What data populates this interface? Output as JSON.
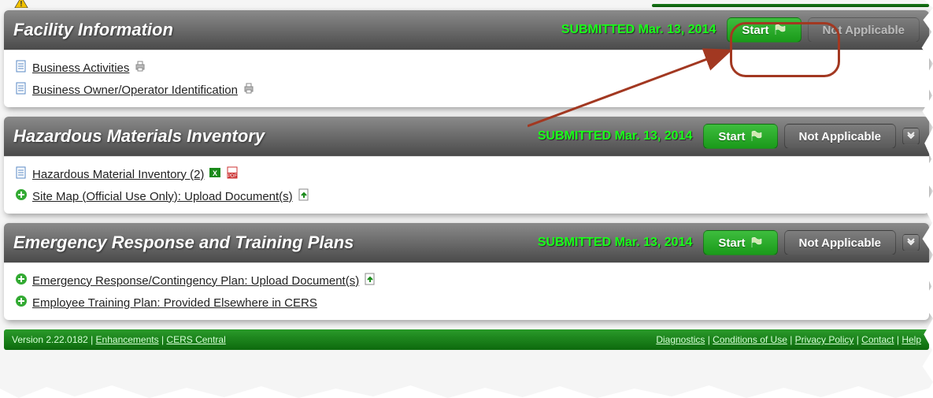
{
  "sections": [
    {
      "title": "Facility Information",
      "status": "SUBMITTED Mar. 13, 2014",
      "start": "Start",
      "na": "Not Applicable",
      "rows": [
        {
          "icon": "doc",
          "text": "Business Activities",
          "trail": "print"
        },
        {
          "icon": "doc",
          "text": "Business Owner/Operator Identification",
          "trail": "print"
        }
      ],
      "highlighted": true,
      "show_na_faded": true
    },
    {
      "title": "Hazardous Materials Inventory",
      "status": "SUBMITTED Mar. 13, 2014",
      "start": "Start",
      "na": "Not Applicable",
      "rows": [
        {
          "icon": "doc",
          "text": "Hazardous Material Inventory (2)",
          "trail": "xlspdf"
        },
        {
          "icon": "plus",
          "text": "Site Map (Official Use Only): Upload Document(s)",
          "trail": "upload"
        }
      ]
    },
    {
      "title": "Emergency Response and Training Plans",
      "status": "SUBMITTED Mar. 13, 2014",
      "start": "Start",
      "na": "Not Applicable",
      "rows": [
        {
          "icon": "plus",
          "text": "Emergency Response/Contingency Plan: Upload Document(s)",
          "trail": "upload"
        },
        {
          "icon": "plus",
          "text": "Employee Training Plan: Provided Elsewhere in CERS",
          "trail": ""
        }
      ]
    }
  ],
  "footer": {
    "left": {
      "version": "Version 2.22.0182",
      "sep": " | ",
      "enh": "Enhancements",
      "central": "CERS Central"
    },
    "right": [
      "Diagnostics",
      "Conditions of Use",
      "Privacy Policy",
      "Contact",
      "Help"
    ]
  }
}
